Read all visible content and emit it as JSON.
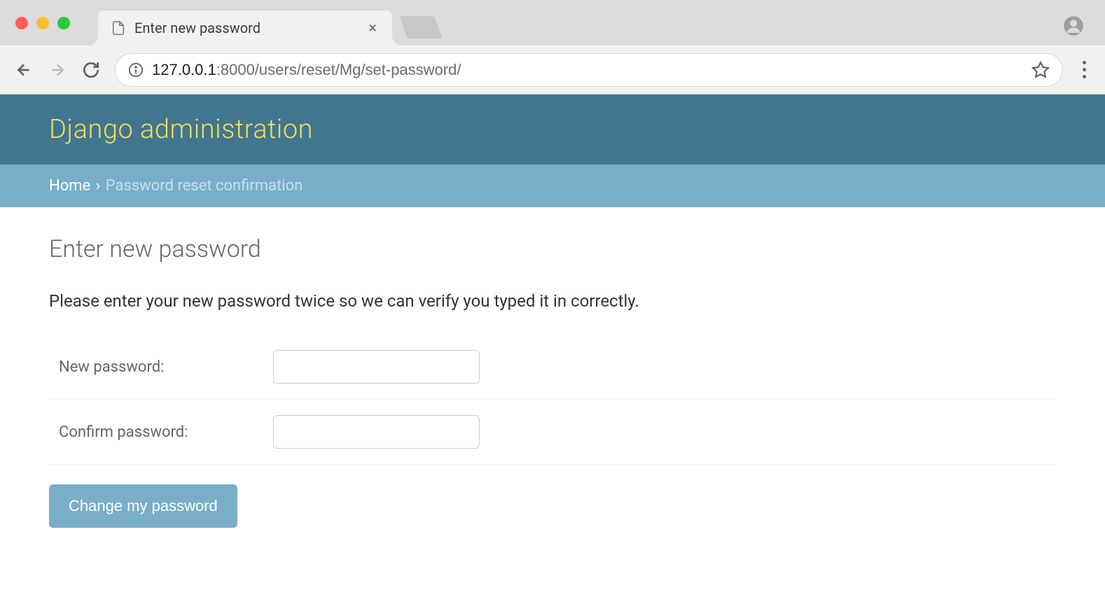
{
  "browser": {
    "tab_title": "Enter new password",
    "url_host": "127.0.0.1",
    "url_port_path": ":8000/users/reset/Mg/set-password/"
  },
  "header": {
    "title": "Django administration"
  },
  "breadcrumb": {
    "home": "Home",
    "separator": "›",
    "current": "Password reset confirmation"
  },
  "page": {
    "heading": "Enter new password",
    "instructions": "Please enter your new password twice so we can verify you typed it in correctly."
  },
  "form": {
    "new_password_label": "New password:",
    "confirm_password_label": "Confirm password:",
    "submit_label": "Change my password"
  }
}
